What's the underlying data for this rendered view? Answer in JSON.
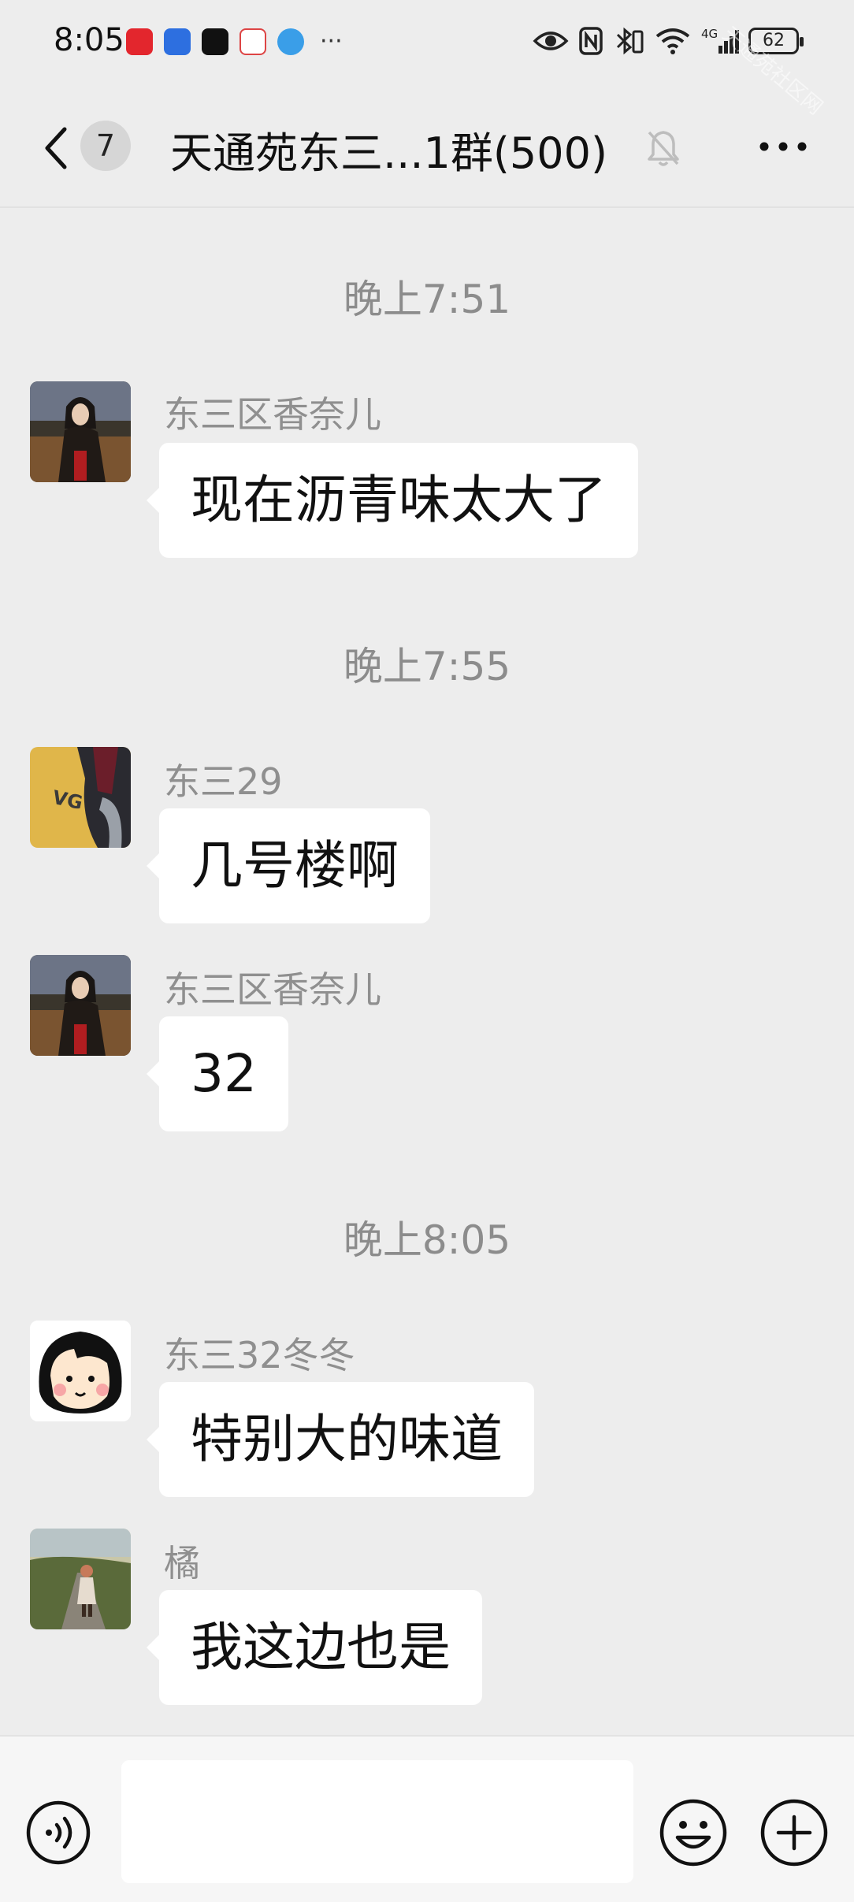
{
  "status_bar": {
    "time": "8:05",
    "battery": "62",
    "network": "4G",
    "apps": [
      "red-app-icon",
      "blue-app-icon",
      "tiktok-icon",
      "cloud-app-icon",
      "globe-app-icon"
    ],
    "more": "···"
  },
  "header": {
    "unread_count": "7",
    "title": "天通苑东三...1群(500)"
  },
  "messages": [
    {
      "timestamp": "晚上7:51",
      "sender": "东三区香奈儿",
      "text": "现在沥青味太大了"
    },
    {
      "timestamp": "晚上7:55",
      "sender": "东三29",
      "text": "几号楼啊"
    },
    {
      "sender": "东三区香奈儿",
      "text": "32"
    },
    {
      "timestamp": "晚上8:05",
      "sender": "东三32冬冬",
      "text": "特别大的味道"
    },
    {
      "sender": "橘",
      "text": "我这边也是"
    }
  ],
  "input": {
    "value": ""
  },
  "colors": {
    "background": "#ededed",
    "bubble": "#ffffff",
    "meta_text": "#8c8c8c"
  }
}
